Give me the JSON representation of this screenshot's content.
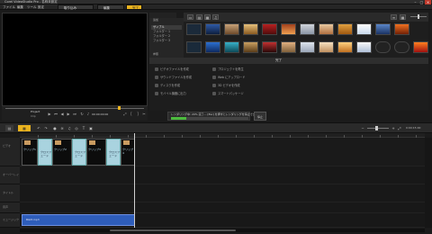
{
  "window": {
    "title": "Corel VideoStudio Pro - 名称未設定",
    "min": "–",
    "max": "□",
    "close": "×"
  },
  "menu": [
    "ファイル",
    "編集",
    "ツール",
    "設定"
  ],
  "steps": [
    {
      "label": "取り込み"
    },
    {
      "label": "編集"
    },
    {
      "label": "完了"
    }
  ],
  "preview": {
    "project_label": "Project",
    "clip_label": "Clip",
    "timecode": "00:00:00:00"
  },
  "library": {
    "folders": [
      "サンプル",
      "フォルダー 1",
      "フォルダー 2",
      "フォルダー 3"
    ],
    "add_label": "追加",
    "browse_label": "参照"
  },
  "options": {
    "header": "完了"
  },
  "tasks": [
    {
      "label": "ビデオファイルを作成"
    },
    {
      "label": "サウンドファイルを作成"
    },
    {
      "label": "ディスクを作成"
    },
    {
      "label": "モバイル機器に出力"
    },
    {
      "label": "プロジェクトを再生"
    },
    {
      "label": "Web にアップロード"
    },
    {
      "label": "3D ビデオを作成"
    },
    {
      "label": "スマートパッケージ"
    }
  ],
  "render": {
    "status": "レンダリング中: 20% 完了... [Esc] を押すとレンダリングを停止できます。",
    "percent": 20,
    "stop": "停止"
  },
  "timeline": {
    "zoom_readout": "0:00:15:00",
    "track_labels": [
      "ビデオ",
      "オーバーレイ",
      "タイトル",
      "音声",
      "ミュージック"
    ]
  },
  "clips": [
    {
      "label": "クリップ1"
    },
    {
      "label": "クリップ2"
    },
    {
      "label": "クリップ3"
    },
    {
      "label": "クリップ4"
    }
  ],
  "transitions": [
    {
      "label": "クロスフェード"
    },
    {
      "label": "クロスフェード"
    },
    {
      "label": "クロスフェード"
    }
  ],
  "audio": {
    "label": "BGM.mp3"
  }
}
